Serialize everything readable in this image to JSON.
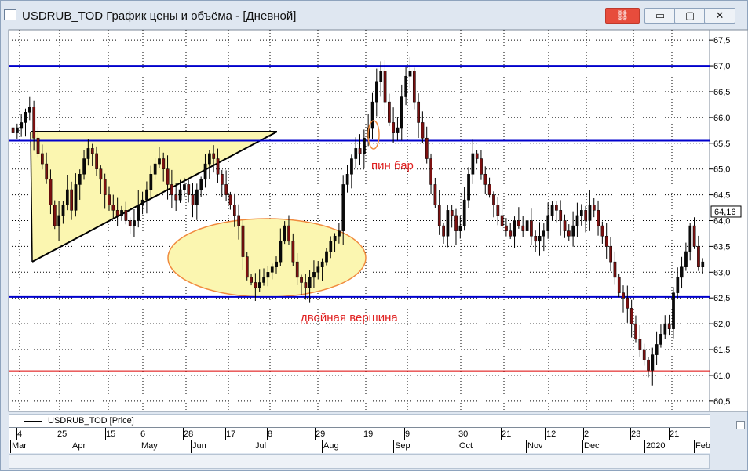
{
  "window": {
    "title": "USDRUB_TOD График цены и объёма - [Дневной]",
    "buttons": {
      "link": "⛓",
      "minimize": "▭",
      "maximize": "▢",
      "close": "✕"
    }
  },
  "legend": {
    "label": "USDRUB_TOD [Price]"
  },
  "colors": {
    "hline": "#0000cc",
    "support_red": "#dd0000",
    "up_candle": "#0a0a0a",
    "down_candle": "#7b1010",
    "pattern_fill": "#fbf6b0",
    "ellipse_stroke": "#f08a3e",
    "annotation": "#e02020"
  },
  "chart_data": {
    "type": "candlestick",
    "ylim": [
      60.3,
      67.7
    ],
    "y_ticks": [
      "67,5",
      "67,0",
      "66,5",
      "66,0",
      "65,5",
      "65,0",
      "64,5",
      "64,0",
      "63,5",
      "63,0",
      "62,5",
      "62,0",
      "61,5",
      "61,0",
      "60,5"
    ],
    "last_price_label": "64,16",
    "x_day_ticks": [
      "4",
      "25",
      "15",
      "6",
      "28",
      "17",
      "8",
      "29",
      "19",
      "9",
      "30",
      "21",
      "12",
      "2",
      "23",
      "21"
    ],
    "x_month_ticks": [
      "Mar",
      "Apr",
      "May",
      "Jun",
      "Jul",
      "Aug",
      "Sep",
      "Oct",
      "Nov",
      "Dec",
      "2020",
      "Feb"
    ],
    "horizontal_lines": [
      {
        "y": 67.0,
        "color": "blue"
      },
      {
        "y": 65.55,
        "color": "blue"
      },
      {
        "y": 62.52,
        "color": "blue"
      },
      {
        "y": 61.08,
        "color": "red"
      }
    ],
    "annotations": [
      {
        "text": "пин бар"
      },
      {
        "text": "двойная вершина"
      }
    ],
    "close_series": [
      65.7,
      65.8,
      65.9,
      66.1,
      66.2,
      65.6,
      65.3,
      65.1,
      64.8,
      64.3,
      63.9,
      64.1,
      64.3,
      64.6,
      64.2,
      64.7,
      64.9,
      65.2,
      65.4,
      65.3,
      65.0,
      64.8,
      64.5,
      64.3,
      64.2,
      64.1,
      64.2,
      64.0,
      63.9,
      64.0,
      64.3,
      64.4,
      64.6,
      64.9,
      65.1,
      65.2,
      65.0,
      64.7,
      64.5,
      64.4,
      64.6,
      64.7,
      64.5,
      64.3,
      64.6,
      64.8,
      65.1,
      65.3,
      65.2,
      64.9,
      64.7,
      64.5,
      64.3,
      64.1,
      63.9,
      63.3,
      62.9,
      62.8,
      62.7,
      62.8,
      62.9,
      63.0,
      63.1,
      63.2,
      63.6,
      63.9,
      63.6,
      63.2,
      62.9,
      62.8,
      62.7,
      62.9,
      63.0,
      63.1,
      63.2,
      63.4,
      63.6,
      63.7,
      63.8,
      64.7,
      64.9,
      65.2,
      65.4,
      65.3,
      65.6,
      65.8,
      66.3,
      66.7,
      66.9,
      66.3,
      65.9,
      65.7,
      65.8,
      66.4,
      66.8,
      66.9,
      66.3,
      65.9,
      65.6,
      65.2,
      64.7,
      64.3,
      63.9,
      63.7,
      64.2,
      64.1,
      63.8,
      63.9,
      64.4,
      64.9,
      65.3,
      65.2,
      64.9,
      64.7,
      64.5,
      64.3,
      64.1,
      63.9,
      63.8,
      63.7,
      64.0,
      63.9,
      63.8,
      64.0,
      63.7,
      63.6,
      63.7,
      63.8,
      64.1,
      64.3,
      64.2,
      64.0,
      63.8,
      63.7,
      63.9,
      64.1,
      64.2,
      64.0,
      64.3,
      64.2,
      63.9,
      63.7,
      63.5,
      63.2,
      62.9,
      62.6,
      62.5,
      62.3,
      62.0,
      61.7,
      61.5,
      61.3,
      61.1,
      61.4,
      61.6,
      61.8,
      62.0,
      61.9,
      62.6,
      62.9,
      63.1,
      63.4,
      63.9,
      63.5,
      63.1,
      63.2
    ]
  }
}
